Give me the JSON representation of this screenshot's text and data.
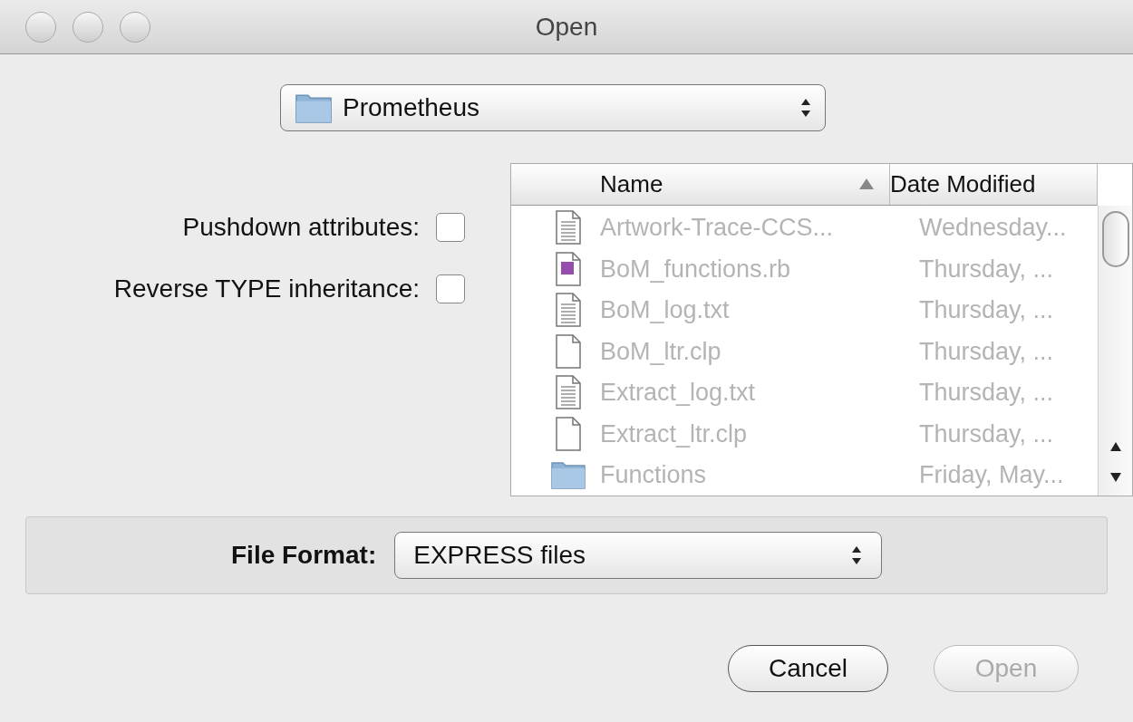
{
  "window": {
    "title": "Open"
  },
  "location": {
    "value": "Prometheus"
  },
  "options": [
    {
      "label": "Pushdown attributes:",
      "checked": false
    },
    {
      "label": "Reverse TYPE inheritance:",
      "checked": false
    }
  ],
  "file_list": {
    "columns": [
      {
        "label": "Name",
        "sorted": true
      },
      {
        "label": "Date Modified",
        "sorted": false
      }
    ],
    "rows": [
      {
        "kind": "text",
        "name": "Artwork-Trace-CCS...",
        "date": "Wednesday...",
        "disabled": true
      },
      {
        "kind": "script",
        "name": "BoM_functions.rb",
        "date": "Thursday, ...",
        "disabled": true
      },
      {
        "kind": "text",
        "name": "BoM_log.txt",
        "date": "Thursday, ...",
        "disabled": true
      },
      {
        "kind": "blank",
        "name": "BoM_ltr.clp",
        "date": "Thursday, ...",
        "disabled": true
      },
      {
        "kind": "text",
        "name": "Extract_log.txt",
        "date": "Thursday, ...",
        "disabled": true
      },
      {
        "kind": "blank",
        "name": "Extract_ltr.clp",
        "date": "Thursday, ...",
        "disabled": true
      },
      {
        "kind": "folder",
        "name": "Functions",
        "date": "Friday, May...",
        "disabled": true
      }
    ]
  },
  "file_format": {
    "label": "File Format:",
    "value": "EXPRESS files"
  },
  "buttons": [
    {
      "label": "Cancel",
      "disabled": false
    },
    {
      "label": "Open",
      "disabled": true
    }
  ]
}
